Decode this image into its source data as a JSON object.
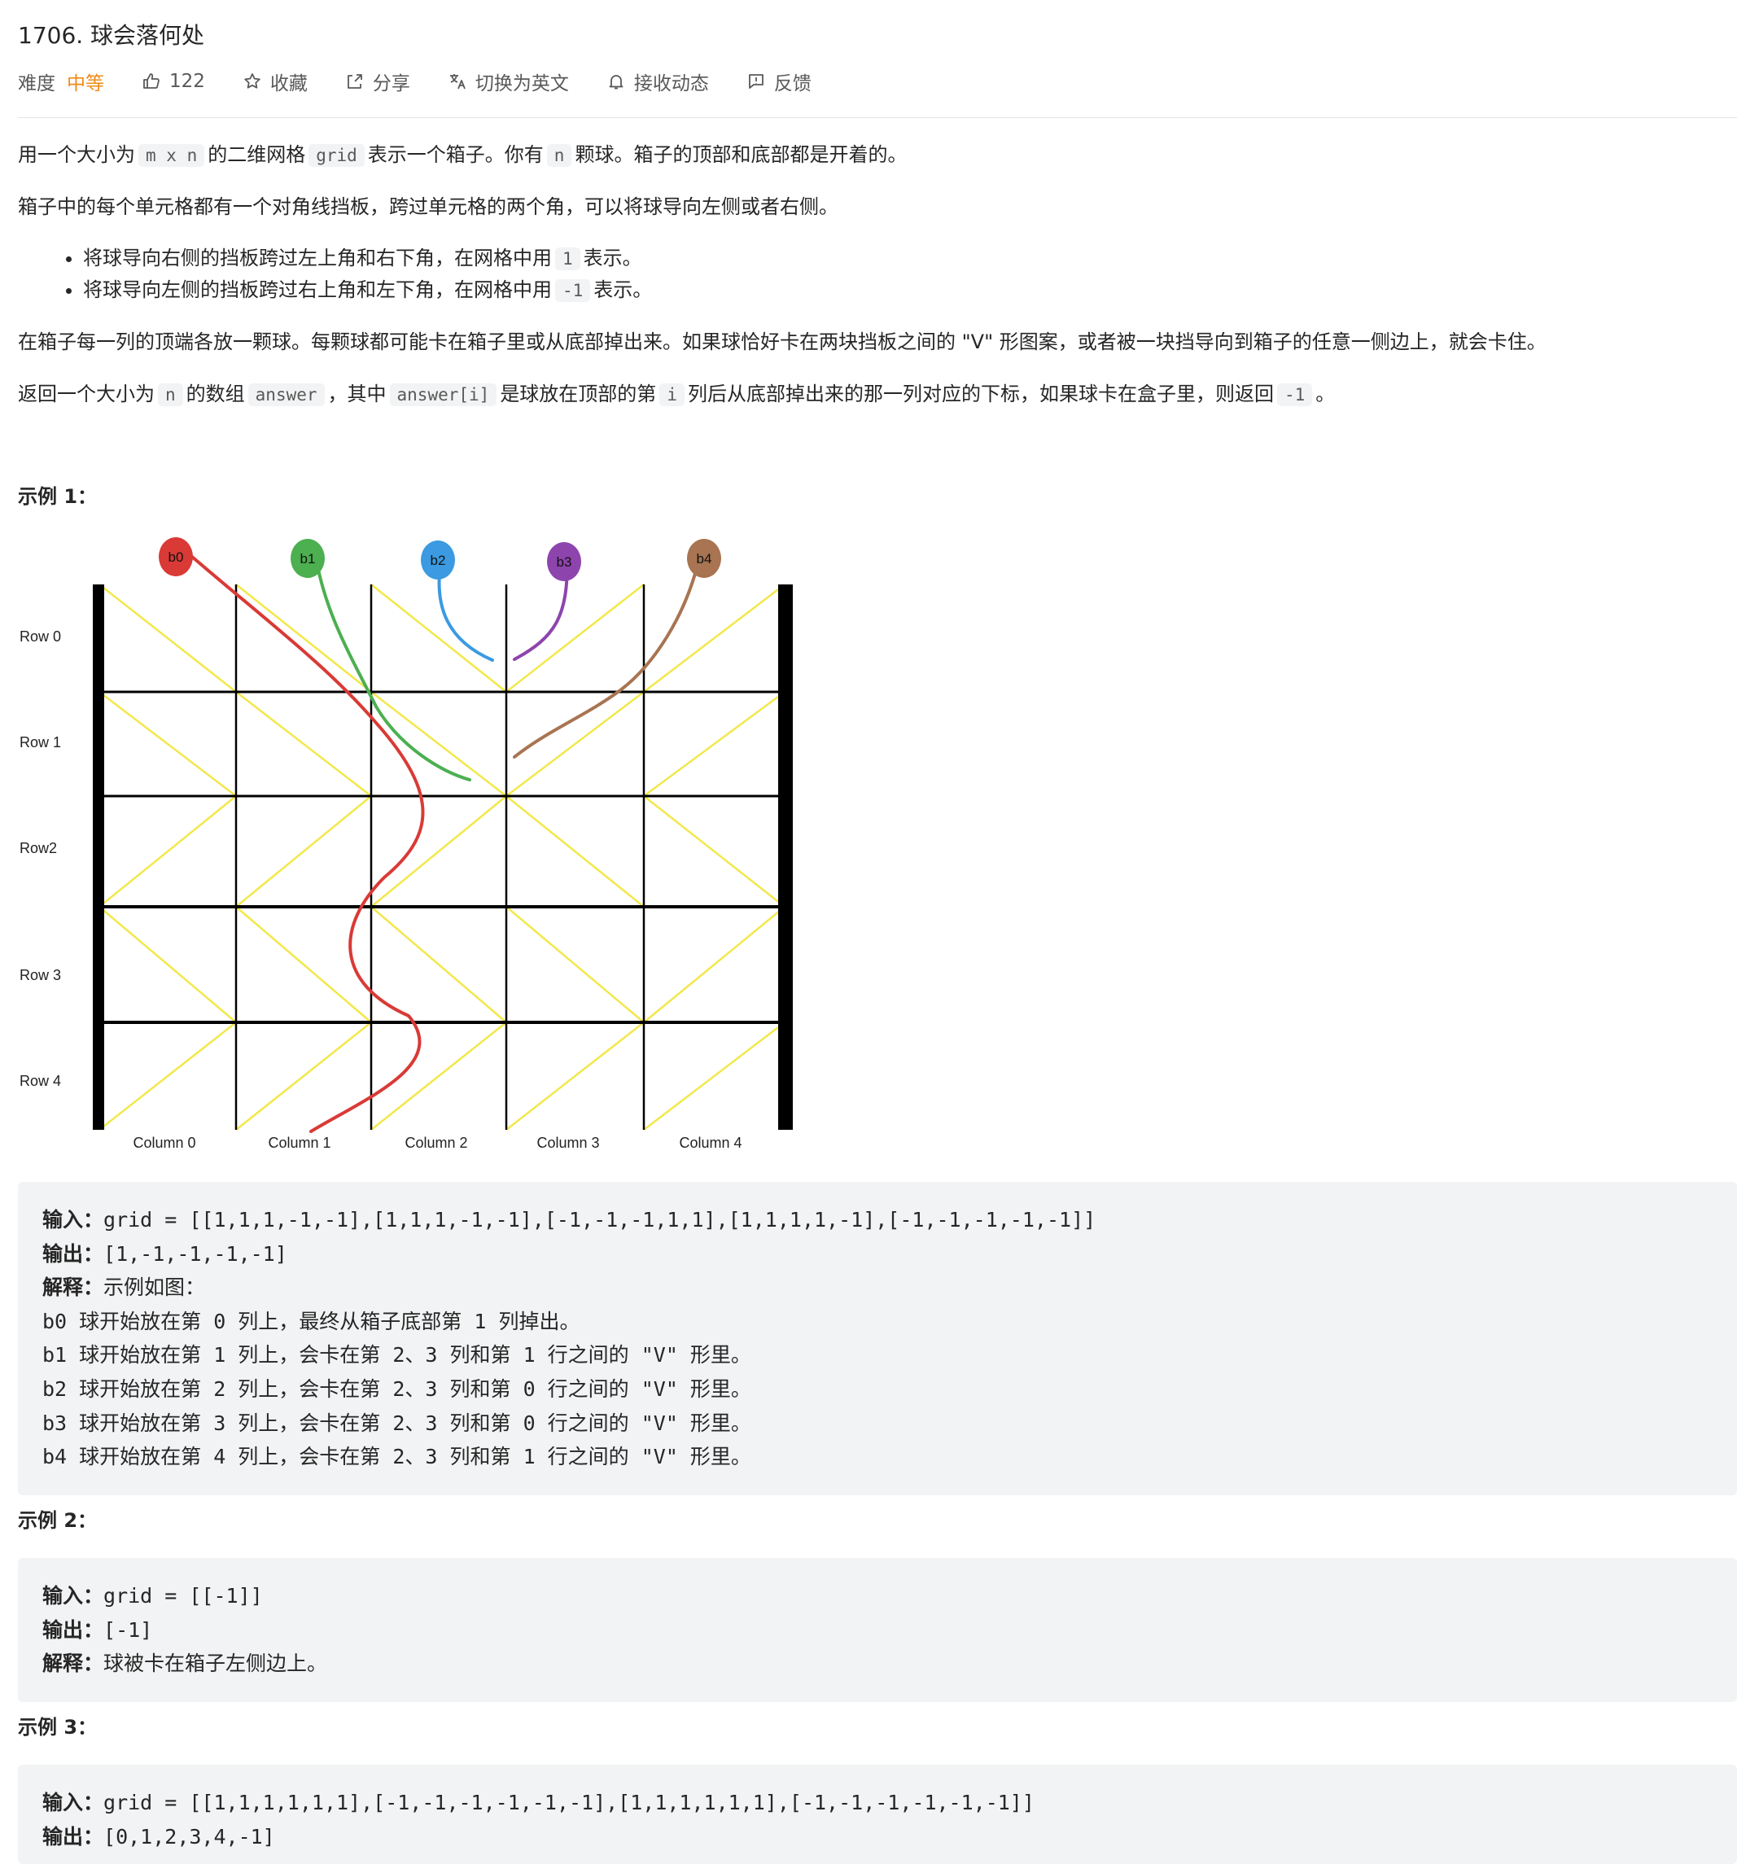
{
  "header": {
    "title": "1706. 球会落何处",
    "difficulty_label": "难度",
    "difficulty_value": "中等",
    "like_count": "122",
    "favorite_label": "收藏",
    "share_label": "分享",
    "translate_label": "切换为英文",
    "subscribe_label": "接收动态",
    "feedback_label": "反馈"
  },
  "description": {
    "p1": [
      "用一个大小为",
      "m x n",
      "的二维网格",
      "grid",
      "表示一个箱子。你有",
      "n",
      "颗球。箱子的顶部和底部都是开着的。"
    ],
    "p2": "箱子中的每个单元格都有一个对角线挡板，跨过单元格的两个角，可以将球导向左侧或者右侧。",
    "bullet1": [
      "将球导向右侧的挡板跨过左上角和右下角，在网格中用",
      "1",
      "表示。"
    ],
    "bullet2": [
      "将球导向左侧的挡板跨过右上角和左下角，在网格中用",
      "-1",
      "表示。"
    ],
    "p3": "在箱子每一列的顶端各放一颗球。每颗球都可能卡在箱子里或从底部掉出来。如果球恰好卡在两块挡板之间的 \"V\" 形图案，或者被一块挡导向到箱子的任意一侧边上，就会卡住。",
    "p4": [
      "返回一个大小为",
      "n",
      "的数组",
      "answer",
      "，其中",
      "answer[i]",
      "是球放在顶部的第",
      "i",
      "列后从底部掉出来的那一列对应的下标，如果球卡在盒子里，则返回",
      "-1",
      "。"
    ]
  },
  "diagram": {
    "balls": [
      "b0",
      "b1",
      "b2",
      "b3",
      "b4"
    ],
    "ball_colors": [
      "#d93a36",
      "#4caf50",
      "#3b9ae1",
      "#8e44ad",
      "#a87451"
    ],
    "rows": [
      "Row 0",
      "Row 1",
      "Row2",
      "Row 3",
      "Row 4"
    ],
    "columns": [
      "Column 0",
      "Column 1",
      "Column 2",
      "Column 3",
      "Column 4"
    ],
    "grid": [
      [
        1,
        1,
        1,
        -1,
        -1
      ],
      [
        1,
        1,
        1,
        -1,
        -1
      ],
      [
        -1,
        -1,
        -1,
        1,
        1
      ],
      [
        1,
        1,
        1,
        1,
        -1
      ],
      [
        -1,
        -1,
        -1,
        -1,
        -1
      ]
    ],
    "baffle_color": "#f2e84a"
  },
  "examples": [
    {
      "heading": "示例 1：",
      "input_label": "输入：",
      "input": "grid = [[1,1,1,-1,-1],[1,1,1,-1,-1],[-1,-1,-1,1,1],[1,1,1,1,-1],[-1,-1,-1,-1,-1]]",
      "output_label": "输出：",
      "output": "[1,-1,-1,-1,-1]",
      "explain_label": "解释：",
      "explain": "示例如图：",
      "extra": [
        "b0 球开始放在第 0 列上，最终从箱子底部第 1 列掉出。",
        "b1 球开始放在第 1 列上，会卡在第 2、3 列和第 1 行之间的 \"V\" 形里。",
        "b2 球开始放在第 2 列上，会卡在第 2、3 列和第 0 行之间的 \"V\" 形里。",
        "b3 球开始放在第 3 列上，会卡在第 2、3 列和第 0 行之间的 \"V\" 形里。",
        "b4 球开始放在第 4 列上，会卡在第 2、3 列和第 1 行之间的 \"V\" 形里。"
      ]
    },
    {
      "heading": "示例 2：",
      "input_label": "输入：",
      "input": "grid = [[-1]]",
      "output_label": "输出：",
      "output": "[-1]",
      "explain_label": "解释：",
      "explain": "球被卡在箱子左侧边上。"
    },
    {
      "heading": "示例 3：",
      "input_label": "输入：",
      "input": "grid = [[1,1,1,1,1,1],[-1,-1,-1,-1,-1,-1],[1,1,1,1,1,1],[-1,-1,-1,-1,-1,-1]]",
      "output_label": "输出：",
      "output": "[0,1,2,3,4,-1]"
    }
  ]
}
